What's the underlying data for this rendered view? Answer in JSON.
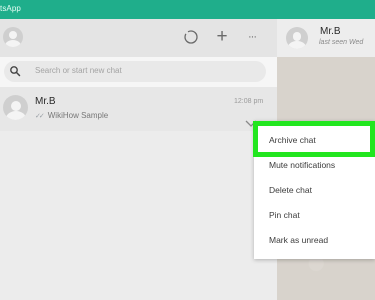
{
  "app": {
    "title": "tsApp",
    "accent": "#1fae8b"
  },
  "left_header": {
    "icons": [
      "status-icon",
      "new-chat-icon",
      "menu-icon"
    ],
    "new_chat_glyph": "+",
    "menu_glyph": "···"
  },
  "search": {
    "placeholder": "Search or start new chat"
  },
  "chats": [
    {
      "name": "Mr.B",
      "time": "12:08 pm",
      "preview": "WikiHow Sample",
      "status_icon": "double-check-icon"
    }
  ],
  "conversation": {
    "contact_name": "Mr.B",
    "status": "last seen Wed"
  },
  "context_menu": {
    "items": [
      {
        "label": "Archive chat",
        "highlighted": true
      },
      {
        "label": "Mute notifications"
      },
      {
        "label": "Delete chat"
      },
      {
        "label": "Pin chat"
      },
      {
        "label": "Mark as unread"
      }
    ],
    "highlight_color": "#22e61f"
  }
}
